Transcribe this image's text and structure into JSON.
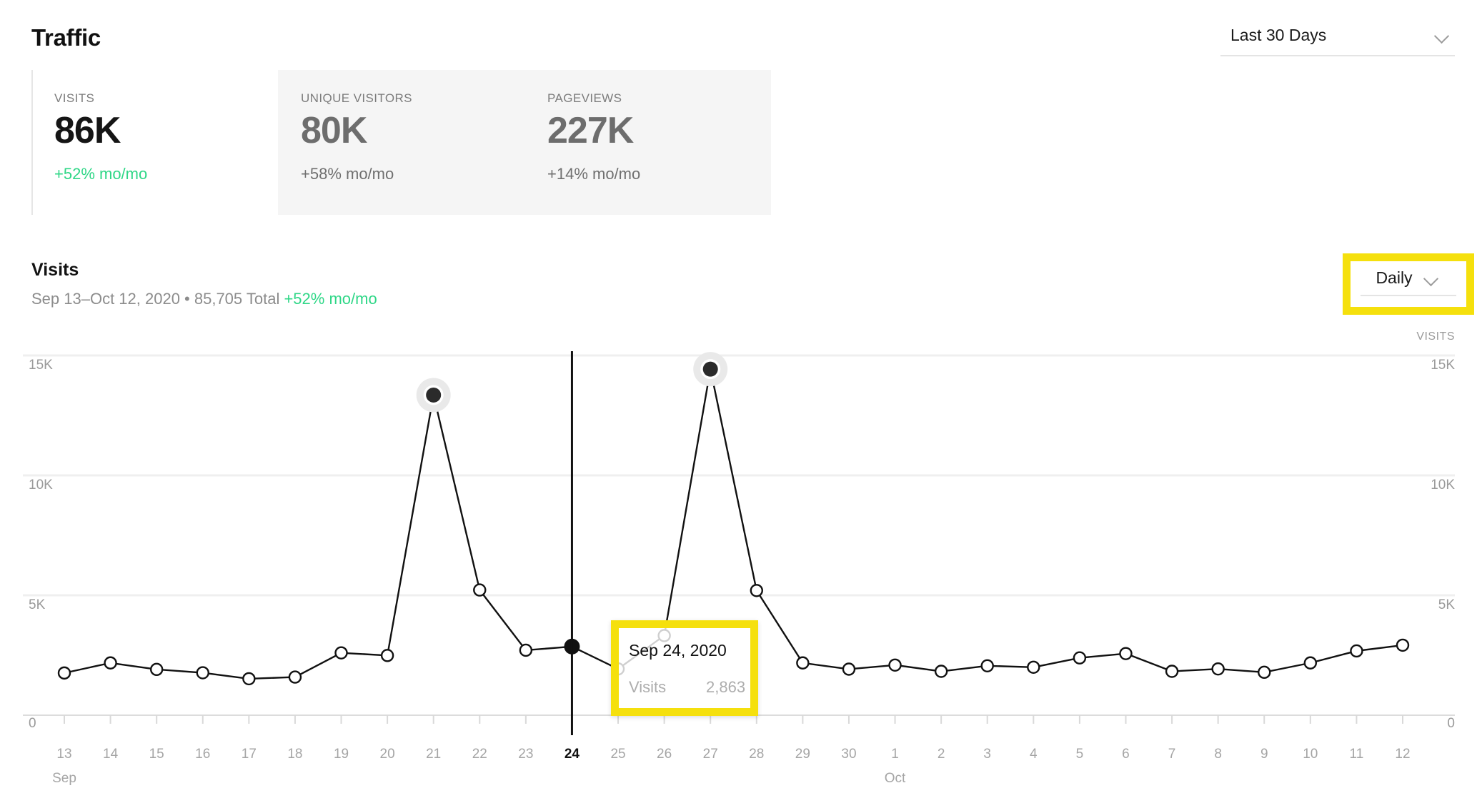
{
  "header": {
    "title": "Traffic",
    "range_select": {
      "value": "Last 30 Days",
      "chevron": "chevron-down-icon"
    }
  },
  "stats": [
    {
      "label": "VISITS",
      "value": "86K",
      "delta": "+52% mo/mo",
      "positive": true
    },
    {
      "label": "UNIQUE VISITORS",
      "value": "80K",
      "delta": "+58% mo/mo",
      "positive": false
    },
    {
      "label": "PAGEVIEWS",
      "value": "227K",
      "delta": "+14% mo/mo",
      "positive": false
    }
  ],
  "section": {
    "title": "Visits",
    "subtitle_range": "Sep 13–Oct 12, 2020 • 85,705 Total ",
    "subtitle_delta": "+52% mo/mo",
    "granularity_select": {
      "value": "Daily",
      "chevron": "chevron-down-icon"
    }
  },
  "tooltip": {
    "date": "Sep 24, 2020",
    "metric_label": "Visits",
    "metric_value": "2,863"
  },
  "colors": {
    "accent_green": "#2fd787",
    "highlight_yellow": "#f5e00d",
    "line": "#111111",
    "gridline": "#efefef",
    "card_bg": "#f5f5f5"
  },
  "chart_data": {
    "type": "line",
    "title": "Visits",
    "xlabel": "",
    "ylabel": "VISITS",
    "ylim": [
      0,
      17000
    ],
    "yticks": [
      0,
      5000,
      10000,
      15000
    ],
    "ytick_labels": [
      "0",
      "5K",
      "10K",
      "15K"
    ],
    "grid": true,
    "legend": null,
    "axis_unit_label": "VISITS",
    "month_labels": [
      {
        "index": 0,
        "label": "Sep"
      },
      {
        "index": 18,
        "label": "Oct"
      }
    ],
    "highlighted_index": 11,
    "peak_indices": [
      8,
      14
    ],
    "categories": [
      "13",
      "14",
      "15",
      "16",
      "17",
      "18",
      "19",
      "20",
      "21",
      "22",
      "23",
      "24",
      "25",
      "26",
      "27",
      "28",
      "29",
      "30",
      "1",
      "2",
      "3",
      "4",
      "5",
      "6",
      "7",
      "8",
      "9",
      "10",
      "11",
      "12"
    ],
    "values": [
      1760,
      2180,
      1910,
      1770,
      1520,
      1590,
      2600,
      2490,
      13350,
      5220,
      2710,
      2863,
      1930,
      3320,
      14430,
      5200,
      2180,
      1920,
      2090,
      1830,
      2060,
      2000,
      2390,
      2570,
      1830,
      1930,
      1790,
      2180,
      2680,
      2920
    ]
  }
}
